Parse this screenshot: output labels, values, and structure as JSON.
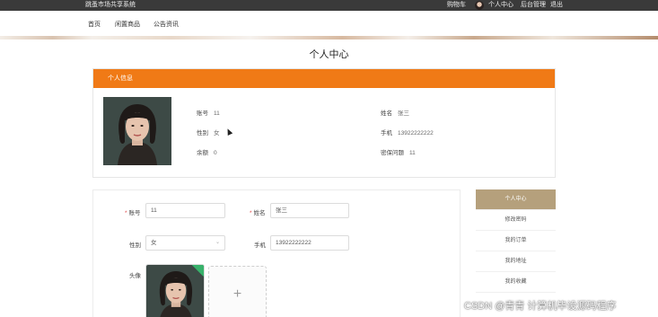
{
  "topbar": {
    "site_name": "跳蚤市场共享系统",
    "cart": "购物车",
    "user_center": "个人中心",
    "admin": "后台管理",
    "logout": "退出"
  },
  "nav": {
    "items": [
      "首页",
      "闲置商品",
      "公告资讯"
    ]
  },
  "page_title": "个人中心",
  "info_card": {
    "header": "个人信息",
    "fields": {
      "account": {
        "label": "账号",
        "value": "11"
      },
      "name": {
        "label": "姓名",
        "value": "张三"
      },
      "gender": {
        "label": "性别",
        "value": "女"
      },
      "phone": {
        "label": "手机",
        "value": "13922222222"
      },
      "balance": {
        "label": "余额",
        "value": "0"
      },
      "security_q": {
        "label": "密保问题",
        "value": "11"
      }
    }
  },
  "form": {
    "account": {
      "label": "账号",
      "value": "11"
    },
    "name": {
      "label": "姓名",
      "value": "张三"
    },
    "gender": {
      "label": "性别",
      "value": "女"
    },
    "phone": {
      "label": "手机",
      "value": "13922222222"
    },
    "avatar_label": "头像",
    "upload_plus": "+",
    "upload_ok": "✓"
  },
  "side_menu": [
    "个人中心",
    "修改密码",
    "我的订单",
    "我的地址",
    "我的收藏"
  ],
  "watermark": "CSDN @青青 计算机毕设源码程序",
  "colors": {
    "header_orange": "#f07a16",
    "side_active": "#b5a07c",
    "topbar": "#3a3a3a"
  }
}
